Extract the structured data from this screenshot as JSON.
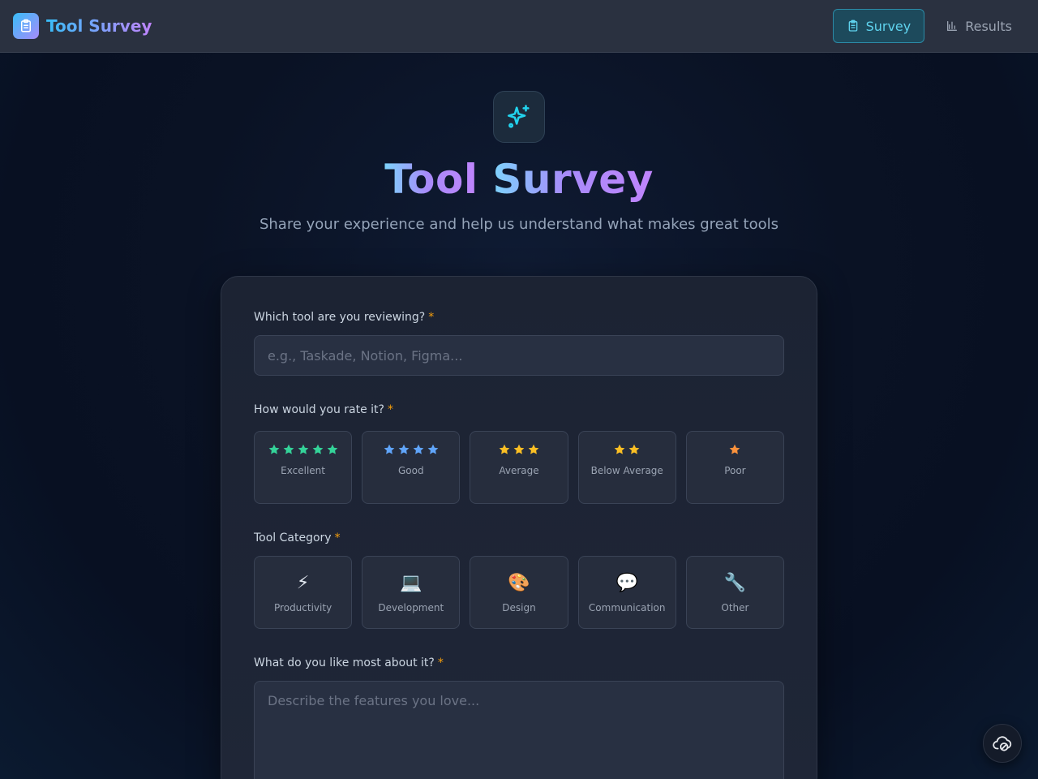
{
  "navbar": {
    "brand": "Tool Survey",
    "tabs": [
      {
        "label": "Survey",
        "icon": "clipboard-icon",
        "active": true
      },
      {
        "label": "Results",
        "icon": "bar-chart-icon",
        "active": false
      }
    ]
  },
  "hero": {
    "title_part1": "Tool",
    "title_part2": "Survey",
    "subtitle": "Share your experience and help us understand what makes great tools"
  },
  "form": {
    "tool_question": "Which tool are you reviewing?",
    "tool_placeholder": "e.g., Taskade, Notion, Figma...",
    "rating_question": "How would you rate it?",
    "ratings": [
      {
        "label": "Excellent",
        "stars": 5,
        "color": "#34d399"
      },
      {
        "label": "Good",
        "stars": 4,
        "color": "#60a5fa"
      },
      {
        "label": "Average",
        "stars": 3,
        "color": "#fbbf24"
      },
      {
        "label": "Below Average",
        "stars": 2,
        "color": "#fbbf24"
      },
      {
        "label": "Poor",
        "stars": 1,
        "color": "#fb923c"
      }
    ],
    "category_question": "Tool Category",
    "categories": [
      {
        "label": "Productivity",
        "icon": "⚡",
        "name": "lightning-icon"
      },
      {
        "label": "Development",
        "icon": "💻",
        "name": "laptop-icon"
      },
      {
        "label": "Design",
        "icon": "🎨",
        "name": "palette-icon"
      },
      {
        "label": "Communication",
        "icon": "💬",
        "name": "speech-bubble-icon"
      },
      {
        "label": "Other",
        "icon": "🔧",
        "name": "wrench-icon"
      }
    ],
    "likes_question": "What do you like most about it?",
    "likes_placeholder": "Describe the features you love...",
    "required_marker": "*"
  },
  "colors": {
    "accent": "#38bdf8",
    "accent_purple": "#c084fc",
    "required": "#f59e0b"
  }
}
